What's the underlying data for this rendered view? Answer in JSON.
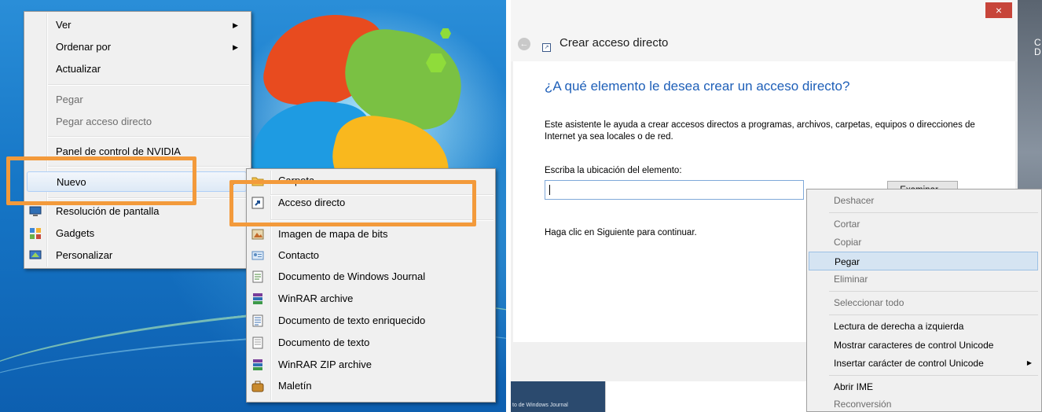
{
  "left": {
    "context_menu": {
      "items": [
        {
          "label": "Ver",
          "submenu": true,
          "disabled": false
        },
        {
          "label": "Ordenar por",
          "submenu": true,
          "disabled": false
        },
        {
          "label": "Actualizar",
          "submenu": false,
          "disabled": false
        },
        {
          "label": "Pegar",
          "submenu": false,
          "disabled": true
        },
        {
          "label": "Pegar acceso directo",
          "submenu": false,
          "disabled": true
        },
        {
          "label": "Panel de control de NVIDIA",
          "submenu": false,
          "disabled": false
        },
        {
          "label": "Nuevo",
          "submenu": true,
          "disabled": false,
          "highlighted": true
        },
        {
          "label": "Resolución de pantalla",
          "icon": "display-icon"
        },
        {
          "label": "Gadgets",
          "icon": "gadgets-icon"
        },
        {
          "label": "Personalizar",
          "icon": "personalize-icon"
        }
      ]
    },
    "submenu": {
      "items": [
        {
          "label": "Carpeta",
          "icon": "folder-icon"
        },
        {
          "label": "Acceso directo",
          "icon": "shortcut-icon",
          "highlighted": true
        },
        {
          "label": "Imagen de mapa de bits",
          "icon": "bitmap-icon"
        },
        {
          "label": "Contacto",
          "icon": "contact-icon"
        },
        {
          "label": "Documento de Windows Journal",
          "icon": "journal-icon"
        },
        {
          "label": "WinRAR archive",
          "icon": "winrar-icon"
        },
        {
          "label": "Documento de texto enriquecido",
          "icon": "rtf-icon"
        },
        {
          "label": "Documento de texto",
          "icon": "text-document-icon"
        },
        {
          "label": "WinRAR ZIP archive",
          "icon": "winrar-zip-icon"
        },
        {
          "label": "Maletín",
          "icon": "briefcase-icon"
        }
      ]
    },
    "callout_color": "#f39a3b"
  },
  "right": {
    "dialog": {
      "title": "Crear acceso directo",
      "close": "×",
      "heading": "¿A qué elemento le desea crear un acceso directo?",
      "description": "Este asistente le ayuda a crear accesos directos a programas, archivos, carpetas, equipos o direcciones de Internet ya sea locales o de red.",
      "location_label": "Escriba la ubicación del elemento:",
      "location_value": "",
      "browse_button": "Examinar...",
      "hint": "Haga clic en Siguiente para continuar."
    },
    "context_menu": {
      "items": [
        {
          "label": "Deshacer",
          "disabled": true
        },
        {
          "label": "Cortar",
          "disabled": true
        },
        {
          "label": "Copiar",
          "disabled": true
        },
        {
          "label": "Pegar",
          "disabled": false,
          "highlighted": true
        },
        {
          "label": "Eliminar",
          "disabled": true
        },
        {
          "label": "Seleccionar todo",
          "disabled": true
        },
        {
          "label": "Lectura de derecha a izquierda",
          "disabled": false
        },
        {
          "label": "Mostrar caracteres de control Unicode",
          "disabled": false
        },
        {
          "label": "Insertar carácter de control Unicode",
          "disabled": false,
          "submenu": true
        },
        {
          "label": "Abrir IME",
          "disabled": false
        },
        {
          "label": "Reconversión",
          "disabled": true
        }
      ]
    },
    "background_fragments": {
      "taskbar_text": "to de Windows Journal",
      "edge_text": "C D"
    },
    "accent_color": "#1e5fb8"
  }
}
